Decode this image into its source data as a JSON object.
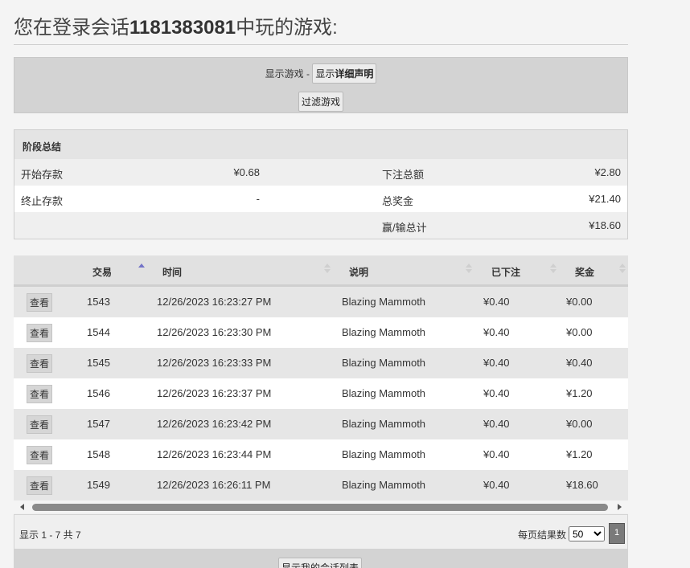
{
  "header": {
    "prefix": "您在登录会话",
    "session_id": "1181383081",
    "suffix": "中玩的游戏:"
  },
  "toolbar": {
    "show_games_label": "显示游戏 -",
    "show_detail_btn_prefix": "显示",
    "show_detail_btn_bold": "详细声明",
    "filter_btn": "过滤游戏"
  },
  "summary": {
    "title": "阶段总结",
    "rows": [
      {
        "label1": "开始存款",
        "value1": "¥0.68",
        "label2": "下注总额",
        "value2": "¥2.80"
      },
      {
        "label1": "终止存款",
        "value1": "-",
        "label2": "总奖金",
        "value2": "¥21.40"
      },
      {
        "label1": "",
        "value1": "",
        "label2": "赢/输总计",
        "value2": "¥18.60"
      }
    ]
  },
  "table": {
    "columns": [
      "交易",
      "时间",
      "说明",
      "已下注",
      "奖金"
    ],
    "view_label": "查看",
    "rows": [
      {
        "id": "1543",
        "time": "12/26/2023 16:23:27 PM",
        "desc": "Blazing Mammoth",
        "bet": "¥0.40",
        "win": "¥0.00"
      },
      {
        "id": "1544",
        "time": "12/26/2023 16:23:30 PM",
        "desc": "Blazing Mammoth",
        "bet": "¥0.40",
        "win": "¥0.00"
      },
      {
        "id": "1545",
        "time": "12/26/2023 16:23:33 PM",
        "desc": "Blazing Mammoth",
        "bet": "¥0.40",
        "win": "¥0.40"
      },
      {
        "id": "1546",
        "time": "12/26/2023 16:23:37 PM",
        "desc": "Blazing Mammoth",
        "bet": "¥0.40",
        "win": "¥1.20"
      },
      {
        "id": "1547",
        "time": "12/26/2023 16:23:42 PM",
        "desc": "Blazing Mammoth",
        "bet": "¥0.40",
        "win": "¥0.00"
      },
      {
        "id": "1548",
        "time": "12/26/2023 16:23:44 PM",
        "desc": "Blazing Mammoth",
        "bet": "¥0.40",
        "win": "¥1.20"
      },
      {
        "id": "1549",
        "time": "12/26/2023 16:26:11 PM",
        "desc": "Blazing Mammoth",
        "bet": "¥0.40",
        "win": "¥18.60"
      }
    ]
  },
  "pager": {
    "info": "显示 1 - 7 共 7",
    "page_size_label": "每页结果数",
    "page_size_selected": "50",
    "current_page": "1"
  },
  "bottom": {
    "show_sessions_btn": "显示我的会话列表"
  },
  "icons": {
    "sort_asc": "sort-ascending-icon",
    "sort_both": "sort-both-icon",
    "scroll_left": "arrow-left-icon",
    "scroll_right": "arrow-right-icon"
  },
  "colors": {
    "sort_active": "#7373c8",
    "page_button": "#7a7a7a"
  }
}
